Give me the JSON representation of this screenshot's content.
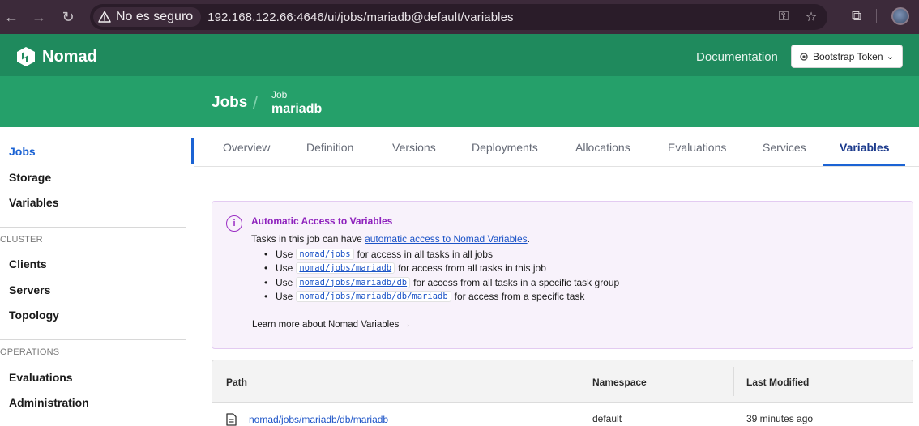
{
  "browser": {
    "security_label": "No es seguro",
    "url": "192.168.122.66:4646/ui/jobs/mariadb@default/variables"
  },
  "header": {
    "brand": "Nomad",
    "documentation": "Documentation",
    "token_button": "Bootstrap Token"
  },
  "breadcrumb": {
    "root": "Jobs",
    "separator": "/",
    "job_label": "Job",
    "job_name": "mariadb"
  },
  "sidebar": {
    "items": [
      "Jobs",
      "Storage",
      "Variables"
    ],
    "cluster_heading": "CLUSTER",
    "cluster_items": [
      "Clients",
      "Servers",
      "Topology"
    ],
    "operations_heading": "OPERATIONS",
    "operations_items": [
      "Evaluations",
      "Administration"
    ]
  },
  "tabs": [
    "Overview",
    "Definition",
    "Versions",
    "Deployments",
    "Allocations",
    "Evaluations",
    "Services",
    "Variables"
  ],
  "active_tab": "Variables",
  "info": {
    "title": "Automatic Access to Variables",
    "intro_before": "Tasks in this job can have ",
    "intro_link": "automatic access to Nomad Variables",
    "intro_after": ".",
    "use_word": "Use",
    "items": [
      {
        "path": "nomad/jobs",
        "desc": "for access in all tasks in all jobs"
      },
      {
        "path": "nomad/jobs/mariadb",
        "desc": "for access from all tasks in this job"
      },
      {
        "path": "nomad/jobs/mariadb/db",
        "desc": "for access from all tasks in a specific task group"
      },
      {
        "path": "nomad/jobs/mariadb/db/mariadb",
        "desc": "for access from a specific task"
      }
    ],
    "learn_more": "Learn more about Nomad Variables",
    "learn_more_arrow": "→"
  },
  "table": {
    "columns": [
      "Path",
      "Namespace",
      "Last Modified"
    ],
    "rows": [
      {
        "path": "nomad/jobs/mariadb/db/mariadb",
        "namespace": "default",
        "last_modified": "39 minutes ago"
      }
    ]
  },
  "colors": {
    "nomad_green": "#1f8a5d",
    "subheader_green": "#25a06a",
    "link_blue": "#1b63d4",
    "info_purple": "#8e22bd"
  }
}
